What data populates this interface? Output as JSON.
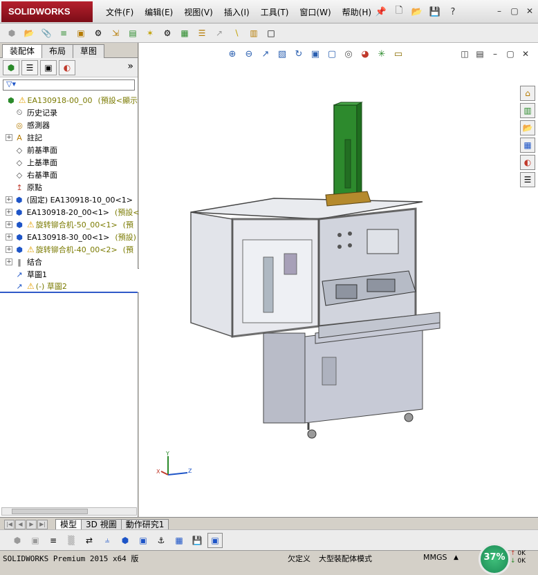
{
  "app": {
    "logo": "SOLIDWORKS"
  },
  "menu": [
    "文件(F)",
    "编辑(E)",
    "视图(V)",
    "插入(I)",
    "工具(T)",
    "窗口(W)",
    "帮助(H)"
  ],
  "panel": {
    "tabs": [
      "装配体",
      "布局",
      "草图"
    ],
    "more_glyph": "»"
  },
  "tree": [
    {
      "text": "EA130918-00_00",
      "extra": "(預設<顯示",
      "warn": true,
      "olive": true,
      "icon": "assembly-icon",
      "expander": false,
      "indent": 0
    },
    {
      "text": "历史记录",
      "icon": "history-icon",
      "expander": false,
      "indent": 1
    },
    {
      "text": "感測器",
      "icon": "sensor-icon",
      "expander": false,
      "indent": 1
    },
    {
      "text": "註記",
      "icon": "annotation-icon",
      "expander": true,
      "indent": 1
    },
    {
      "text": "前基準面",
      "icon": "plane-icon",
      "expander": false,
      "indent": 1
    },
    {
      "text": "上基準面",
      "icon": "plane-icon",
      "expander": false,
      "indent": 1
    },
    {
      "text": "右基準面",
      "icon": "plane-icon",
      "expander": false,
      "indent": 1
    },
    {
      "text": "原點",
      "icon": "origin-icon",
      "expander": false,
      "indent": 1
    },
    {
      "text": "(固定) EA130918-10_00<1>",
      "extra": "(",
      "icon": "subassembly-icon",
      "expander": true,
      "indent": 1
    },
    {
      "text": "EA130918-20_00<1>",
      "extra": "(預設<顯",
      "icon": "subassembly-icon",
      "expander": true,
      "indent": 1
    },
    {
      "text": "旋转铆合机-50_00<1>",
      "extra": "(預",
      "warn": true,
      "olive": true,
      "icon": "subassembly-icon",
      "expander": true,
      "indent": 1
    },
    {
      "text": "EA130918-30_00<1>",
      "extra": "(預設)",
      "icon": "subassembly-icon",
      "expander": true,
      "indent": 1
    },
    {
      "text": "旋转铆合机-40_00<2>",
      "extra": "(預",
      "warn": true,
      "olive": true,
      "icon": "subassembly-icon",
      "expander": true,
      "indent": 1
    },
    {
      "text": "结合",
      "icon": "mates-icon",
      "expander": true,
      "indent": 1
    },
    {
      "text": "草圖1",
      "icon": "sketch-icon",
      "expander": false,
      "indent": 1
    },
    {
      "text": "(-) 草圖2",
      "warn": true,
      "olive": true,
      "icon": "sketch-icon",
      "expander": false,
      "indent": 1
    }
  ],
  "bottom_tabs": [
    "模型",
    "3D 視圖",
    "動作研究1"
  ],
  "status": {
    "product": "SOLIDWORKS Premium 2015 x64 版",
    "definition": "欠定义",
    "mode": "大型裝配体模式",
    "units": "MMGS",
    "arrow": "▲",
    "percent": "37%",
    "rate_up": "0K",
    "rate_down": "0K"
  },
  "triad": {
    "y": "Y",
    "x": "X",
    "z": "Z"
  },
  "colors": {
    "accent": "#c8102e",
    "selection": "#2f59c8",
    "warn": "#e3a000",
    "model_green": "#2d8a2d"
  }
}
